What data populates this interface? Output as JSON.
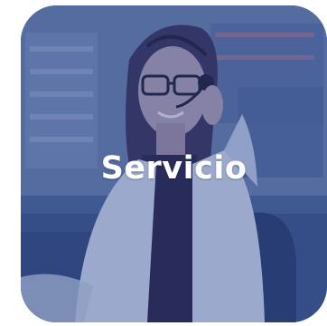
{
  "card": {
    "label": "Servicio",
    "image_subject": "customer-service-agent-with-headset",
    "overlay_color": "#2f4a8a"
  }
}
